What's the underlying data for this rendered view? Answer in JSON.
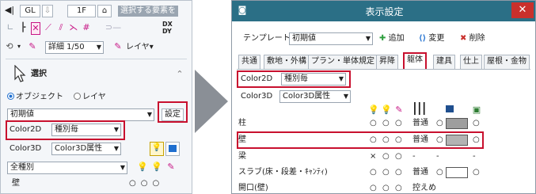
{
  "left_panel": {
    "toolbar1": {
      "gl_label": "GL",
      "floor_label": "1F",
      "hint": "選択する要素を"
    },
    "toolbar2": {
      "dx_label": "DX\nDY"
    },
    "toolbar3": {
      "detail_label": "詳細 1/50",
      "layer_label": "レイヤ"
    },
    "select_header": "選択",
    "mode_object": "オブジェクト",
    "mode_layer": "レイヤ",
    "preset_value": "初期値",
    "settings_button": "設定",
    "color2d_label": "Color2D",
    "color2d_value": "種別毎",
    "color3d_label": "Color3D",
    "color3d_value": "Color3D属性",
    "all_types_value": "全種別",
    "wall_label": "壁"
  },
  "dialog": {
    "title": "表示設定",
    "template_label": "テンプレート",
    "template_value": "初期値",
    "add_label": "追加",
    "change_label": "変更",
    "delete_label": "削除",
    "tabs": [
      "共通",
      "敷地・外構",
      "プラン・単体規定",
      "昇降",
      "躯体",
      "建具",
      "仕上",
      "屋根・金物"
    ],
    "color2d_label": "Color2D",
    "color2d_value": "種別毎",
    "color3d_label": "Color3D",
    "color3d_value": "Color3D属性",
    "rows": [
      {
        "name": "柱",
        "v1": "○",
        "v2": "○",
        "v3": "○",
        "linetype": "普通",
        "v4": "○",
        "v5": "○",
        "swatch": "#9e9e9e"
      },
      {
        "name": "壁",
        "v1": "○",
        "v2": "○",
        "v3": "○",
        "linetype": "普通",
        "v4": "○",
        "v5": "○",
        "swatch": "#b3b3b3"
      },
      {
        "name": "梁",
        "v1": "×",
        "v2": "○",
        "v3": "○",
        "linetype": "-",
        "v4": "-",
        "v5": "-",
        "swatch": ""
      },
      {
        "name": "スラブ(床・段差・ｷｬﾝﾃｨ)",
        "v1": "○",
        "v2": "○",
        "v3": "○",
        "linetype": "普通",
        "v4": "○",
        "v5": "○",
        "swatch": "#ffffff"
      },
      {
        "name": "開口(壁)",
        "v1": "○",
        "v2": "○",
        "v3": "○",
        "linetype": "控えめ",
        "v4": "",
        "v5": "",
        "swatch": ""
      }
    ]
  },
  "colors": {
    "highlight": "#c8102e",
    "titlebar": "#2b6f86",
    "close": "#c9302c"
  }
}
